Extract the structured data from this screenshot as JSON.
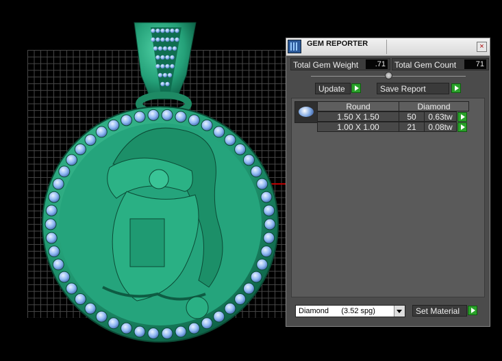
{
  "colors": {
    "panel_bg": "#4b4b4b",
    "accent_green": "#2aa12a",
    "model": "#2fa57e",
    "gem": "#8fb8f2"
  },
  "gem_reporter": {
    "title": "GEM REPORTER",
    "close_label": "×",
    "total_gem_weight_label": "Total Gem Weight",
    "total_gem_weight_value": ".71",
    "total_gem_count_label": "Total Gem Count",
    "total_gem_count_value": "71",
    "update_label": "Update",
    "save_report_label": "Save Report",
    "table": {
      "shape_header": "Round",
      "material_header": "Diamond",
      "rows": [
        {
          "size": "1.50 X 1.50",
          "count": "50",
          "weight": "0.63tw"
        },
        {
          "size": "1.00 X 1.00",
          "count": "21",
          "weight": "0.08tw"
        }
      ]
    },
    "material_select_value": "Diamond      (3.52 spg)",
    "set_material_label": "Set Material"
  }
}
